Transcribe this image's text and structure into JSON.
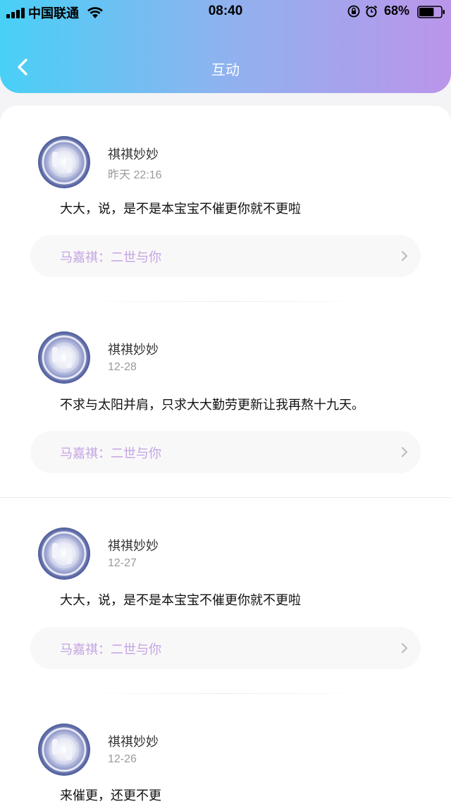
{
  "status_bar": {
    "carrier": "中国联通",
    "time": "08:40",
    "battery_percent": "68%",
    "battery_level": 0.68
  },
  "header": {
    "title": "互动",
    "back_icon": "chevron-left-icon"
  },
  "comments": [
    {
      "user": "祺祺妙妙",
      "time": "昨天 22:16",
      "text": "大大，说，是不是本宝宝不催更你就不更啦",
      "work_label": "马嘉祺：二世与你"
    },
    {
      "user": "祺祺妙妙",
      "time": "12-28",
      "text": "不求与太阳并肩，只求大大勤劳更新让我再熬十九天。",
      "work_label": "马嘉祺：二世与你"
    },
    {
      "user": "祺祺妙妙",
      "time": "12-27",
      "text": "大大，说，是不是本宝宝不催更你就不更啦",
      "work_label": "马嘉祺：二世与你"
    },
    {
      "user": "祺祺妙妙",
      "time": "12-26",
      "text": "来催更，还更不更",
      "work_label": ""
    }
  ],
  "colors": {
    "header_gradient_start": "#48d0f6",
    "header_gradient_end": "#bb95ea",
    "work_label": "#c5a3e4"
  }
}
